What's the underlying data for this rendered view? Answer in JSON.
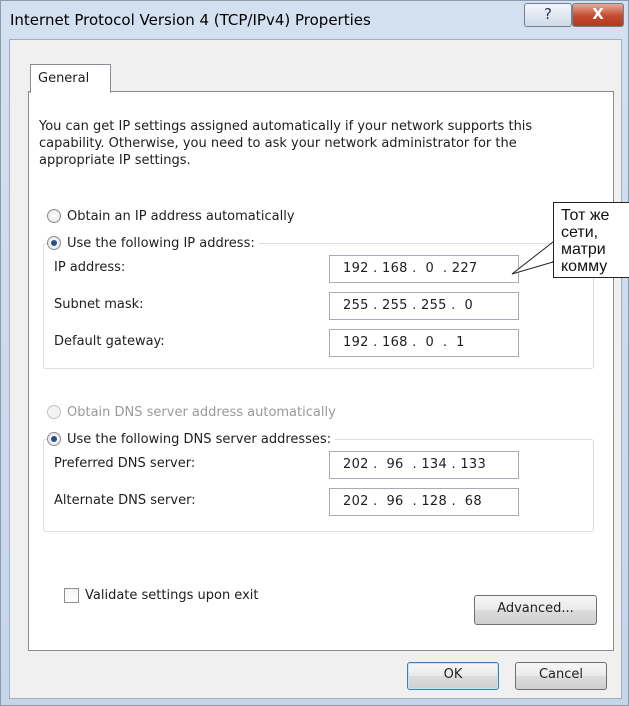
{
  "window": {
    "title": "Internet Protocol Version 4 (TCP/IPv4) Properties",
    "help_glyph": "?",
    "close_glyph": "X"
  },
  "tabs": [
    {
      "label": "General"
    }
  ],
  "intro_text": "You can get IP settings assigned automatically if your network supports this capability. Otherwise, you need to ask your network administrator for the appropriate IP settings.",
  "ip_section": {
    "auto_label": "Obtain an IP address automatically",
    "auto_selected": false,
    "manual_label": "Use the following IP address:",
    "manual_selected": true,
    "fields": [
      {
        "label": "IP address:",
        "value": "192 . 168 .  0  . 227"
      },
      {
        "label": "Subnet mask:",
        "value": "255 . 255 . 255 .  0"
      },
      {
        "label": "Default gateway:",
        "value": "192 . 168 .  0  .  1"
      }
    ]
  },
  "dns_section": {
    "auto_label": "Obtain DNS server address automatically",
    "auto_selected": false,
    "auto_enabled": false,
    "manual_label": "Use the following DNS server addresses:",
    "manual_selected": true,
    "fields": [
      {
        "label": "Preferred DNS server:",
        "value": "202 .  96  . 134 . 133"
      },
      {
        "label": "Alternate DNS server:",
        "value": "202 .  96  . 128 .  68"
      }
    ]
  },
  "validate_label": "Validate settings upon exit",
  "validate_checked": false,
  "buttons": {
    "advanced": "Advanced...",
    "ok": "OK",
    "cancel": "Cancel"
  },
  "callout": {
    "lines": [
      "Тот же",
      "сети,",
      "матри",
      "комму"
    ]
  }
}
